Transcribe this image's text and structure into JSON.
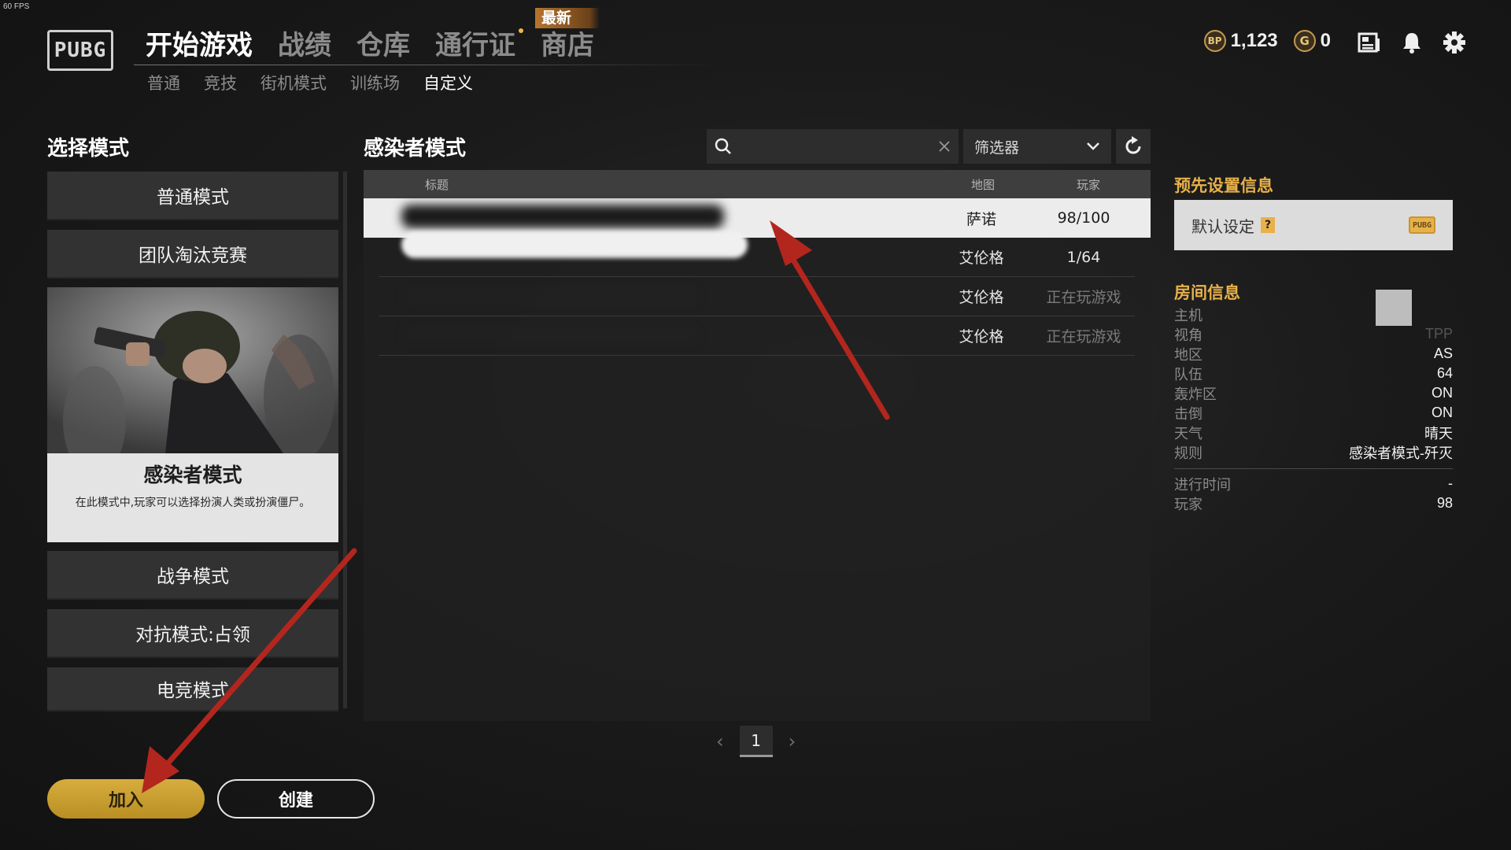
{
  "fps": "60 FPS",
  "logo_text": "PUBG",
  "top_nav": [
    {
      "label": "开始游戏",
      "active": true
    },
    {
      "label": "战绩",
      "active": false
    },
    {
      "label": "仓库",
      "active": false
    },
    {
      "label": "通行证",
      "active": false
    },
    {
      "label": "商店",
      "active": false
    }
  ],
  "new_badge": "最新",
  "sub_nav": [
    {
      "label": "普通",
      "active": false
    },
    {
      "label": "竞技",
      "active": false
    },
    {
      "label": "街机模式",
      "active": false
    },
    {
      "label": "训练场",
      "active": false
    },
    {
      "label": "自定义",
      "active": true
    }
  ],
  "currency": {
    "bp_icon": "BP",
    "bp_value": "1,123",
    "g_icon": "G",
    "g_value": "0"
  },
  "icons": [
    "news-icon",
    "bell-icon",
    "gear-icon"
  ],
  "left": {
    "title": "选择模式",
    "modes": [
      "普通模式",
      "团队淘汰竞赛"
    ],
    "selected_mode": {
      "title": "感染者模式",
      "description": "在此模式中,玩家可以选择扮演人类或扮演僵尸。"
    },
    "modes_after": [
      "战争模式",
      "对抗模式:占领",
      "电竞模式"
    ]
  },
  "list": {
    "title": "感染者模式",
    "search_placeholder": "",
    "filter_label": "筛选器",
    "columns": {
      "title": "标题",
      "map": "地图",
      "players": "玩家"
    },
    "rows": [
      {
        "map": "萨诺",
        "players": "98/100",
        "selected": true
      },
      {
        "map": "艾伦格",
        "players": "1/64",
        "selected": false
      },
      {
        "map": "艾伦格",
        "players": "正在玩游戏",
        "selected": false
      },
      {
        "map": "艾伦格",
        "players": "正在玩游戏",
        "selected": false
      }
    ],
    "page": "1"
  },
  "right": {
    "preset_title": "预先设置信息",
    "preset_value": "默认设定",
    "preset_help": "?",
    "preset_logo": "PUBG",
    "room_title": "房间信息",
    "info": [
      {
        "k": "主机",
        "v": ""
      },
      {
        "k": "视角",
        "v": "TPP"
      },
      {
        "k": "地区",
        "v": "AS"
      },
      {
        "k": "队伍",
        "v": "64"
      },
      {
        "k": "轰炸区",
        "v": "ON"
      },
      {
        "k": "击倒",
        "v": "ON"
      },
      {
        "k": "天气",
        "v": "晴天"
      },
      {
        "k": "规则",
        "v": "感染者模式-歼灭"
      }
    ],
    "info2": [
      {
        "k": "进行时间",
        "v": "-"
      },
      {
        "k": "玩家",
        "v": "98"
      }
    ]
  },
  "buttons": {
    "join": "加入",
    "create": "创建"
  },
  "colors": {
    "accent": "#e8b14a",
    "join_button": "#c9a032",
    "annotation_arrow": "#b3261e"
  }
}
